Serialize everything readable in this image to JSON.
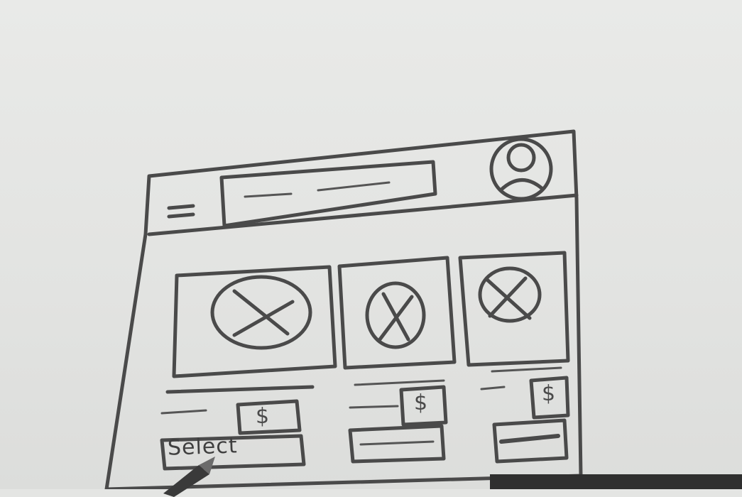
{
  "header": {
    "menu_icon": "hamburger-menu-icon",
    "search": "search-bar-placeholder",
    "avatar_icon": "user-avatar-icon"
  },
  "cards": [
    {
      "image_icon": "image-placeholder-icon",
      "price": "$",
      "button_label": "Select"
    },
    {
      "image_icon": "image-placeholder-icon",
      "price": "$",
      "button_label": ""
    },
    {
      "image_icon": "image-placeholder-icon",
      "price": "$",
      "button_label": ""
    }
  ],
  "colors": {
    "ink": "#4a4a4a",
    "paper": "#e4e5e3"
  }
}
